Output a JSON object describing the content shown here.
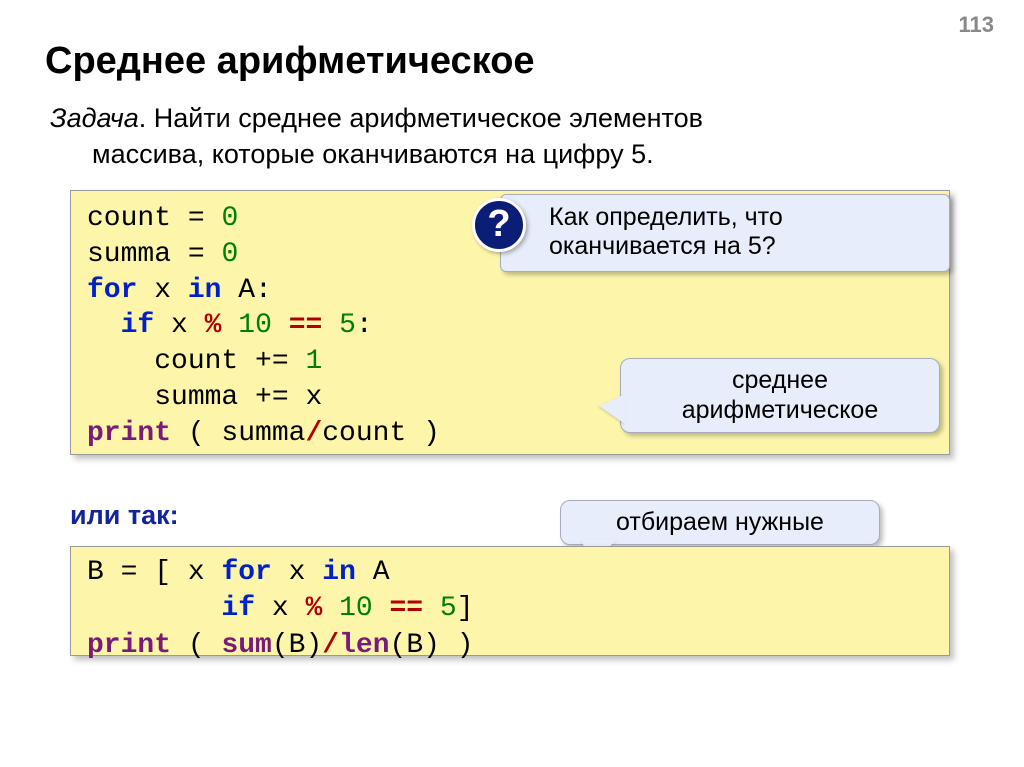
{
  "page_number": "113",
  "title": "Среднее арифметическое",
  "task": {
    "label": "Задача",
    "line1_rest": ". Найти среднее арифметическое элементов",
    "line2": "массива, которые оканчиваются на цифру 5."
  },
  "code1": {
    "l1a": "count",
    "l1b": " = ",
    "l1c": "0",
    "l2a": "summa",
    "l2b": " = ",
    "l2c": "0",
    "l3a": "for",
    "l3b": " x ",
    "l3c": "in",
    "l3d": " A:",
    "l4a": "  ",
    "l4b": "if",
    "l4c": " x ",
    "l4d": "%",
    "l4e": " ",
    "l4f": "10",
    "l4g": " ",
    "l4h": "==",
    "l4i": " ",
    "l4j": "5",
    "l4k": ":",
    "l5a": "    count",
    "l5b": " += ",
    "l5c": "1",
    "l6a": "    summa",
    "l6b": " += ",
    "l6c": "x",
    "l7a": "print",
    "l7b": " ( summa",
    "l7c": "/",
    "l7d": "count )"
  },
  "or_label": "или так:",
  "code2": {
    "l1a": "B",
    "l1b": " = ",
    "l1c": "[ x ",
    "l1d": "for",
    "l1e": " x ",
    "l1f": "in",
    "l1g": " A",
    "l2a": "        ",
    "l2b": "if",
    "l2c": " x ",
    "l2d": "%",
    "l2e": " ",
    "l2f": "10",
    "l2g": " ",
    "l2h": "==",
    "l2i": " ",
    "l2j": "5",
    "l2k": "]",
    "l3a": "print",
    "l3b": " ( ",
    "l3c": "sum",
    "l3d": "(B)",
    "l3e": "/",
    "l3f": "len",
    "l3g": "(B) )"
  },
  "callouts": {
    "q_badge": "?",
    "question_l1": "Как определить, что",
    "question_l2": "оканчивается на 5?",
    "mean_l1": "среднее",
    "mean_l2": "арифметическое",
    "filter": "отбираем нужные"
  }
}
